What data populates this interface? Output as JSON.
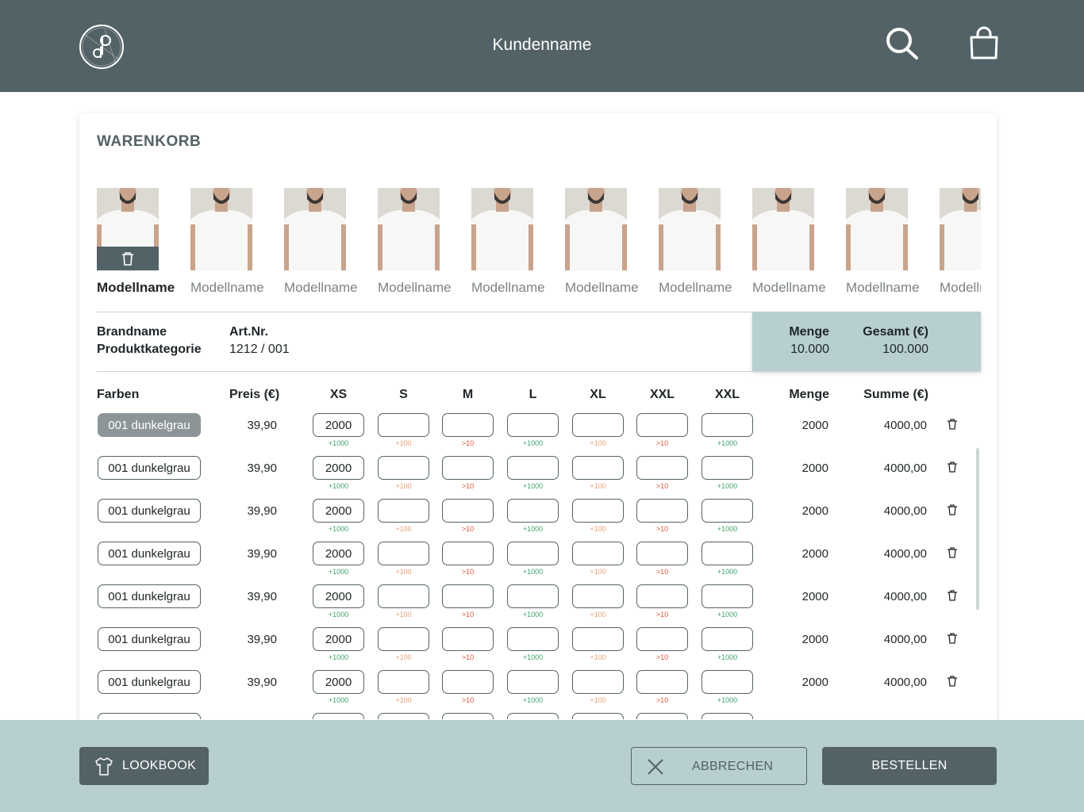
{
  "header": {
    "title": "Kundenname",
    "logo_icon": "dp-logo-icon",
    "search_icon": "search-icon",
    "cart_icon": "shopping-bag-icon"
  },
  "card": {
    "title": "WARENKORB"
  },
  "products": [
    {
      "label": "Modellname",
      "selected": true
    },
    {
      "label": "Modellname",
      "selected": false
    },
    {
      "label": "Modellname",
      "selected": false
    },
    {
      "label": "Modellname",
      "selected": false
    },
    {
      "label": "Modellname",
      "selected": false
    },
    {
      "label": "Modellname",
      "selected": false
    },
    {
      "label": "Modellname",
      "selected": false
    },
    {
      "label": "Modellname",
      "selected": false
    },
    {
      "label": "Modellname",
      "selected": false
    },
    {
      "label": "Modellname",
      "selected": false
    }
  ],
  "product_info": {
    "brand": "Brandname",
    "category": "Produktkategorie",
    "art_label": "Art.Nr.",
    "art_number": "1212 / 001",
    "qty_label": "Menge",
    "qty_value": "10.000",
    "total_label": "Gesamt (€)",
    "total_value": "100.000"
  },
  "table": {
    "headers": {
      "colors": "Farben",
      "price": "Preis (€)",
      "sizes": [
        "XS",
        "S",
        "M",
        "L",
        "XL",
        "XXL",
        "XXL"
      ],
      "qty": "Menge",
      "sum": "Summe (€)"
    },
    "hints": [
      "+1000",
      "+100",
      ">10",
      "+1000",
      "+100",
      ">10",
      "+1000"
    ],
    "hint_colors": [
      "#3fa36a",
      "#e8a07a",
      "#e0553a",
      "#3fa36a",
      "#e8a07a",
      "#e0553a",
      "#3fa36a"
    ],
    "rows": [
      {
        "color": "001 dunkelgrau",
        "active": true,
        "price": "39,90",
        "sizes": [
          "2000",
          "",
          "",
          "",
          "",
          "",
          ""
        ],
        "qty": "2000",
        "sum": "4000,00"
      },
      {
        "color": "001 dunkelgrau",
        "active": false,
        "price": "39,90",
        "sizes": [
          "2000",
          "",
          "",
          "",
          "",
          "",
          ""
        ],
        "qty": "2000",
        "sum": "4000,00"
      },
      {
        "color": "001 dunkelgrau",
        "active": false,
        "price": "39,90",
        "sizes": [
          "2000",
          "",
          "",
          "",
          "",
          "",
          ""
        ],
        "qty": "2000",
        "sum": "4000,00"
      },
      {
        "color": "001 dunkelgrau",
        "active": false,
        "price": "39,90",
        "sizes": [
          "2000",
          "",
          "",
          "",
          "",
          "",
          ""
        ],
        "qty": "2000",
        "sum": "4000,00"
      },
      {
        "color": "001 dunkelgrau",
        "active": false,
        "price": "39,90",
        "sizes": [
          "2000",
          "",
          "",
          "",
          "",
          "",
          ""
        ],
        "qty": "2000",
        "sum": "4000,00"
      },
      {
        "color": "001 dunkelgrau",
        "active": false,
        "price": "39,90",
        "sizes": [
          "2000",
          "",
          "",
          "",
          "",
          "",
          ""
        ],
        "qty": "2000",
        "sum": "4000,00"
      },
      {
        "color": "001 dunkelgrau",
        "active": false,
        "price": "39,90",
        "sizes": [
          "2000",
          "",
          "",
          "",
          "",
          "",
          ""
        ],
        "qty": "2000",
        "sum": "4000,00"
      },
      {
        "color": "",
        "active": false,
        "price": "",
        "sizes": [
          "",
          "",
          "",
          "",
          "",
          "",
          ""
        ],
        "qty": "",
        "sum": ""
      }
    ]
  },
  "footer": {
    "lookbook_label": "LOOKBOOK",
    "cancel_label": "ABBRECHEN",
    "order_label": "BESTELLEN"
  },
  "colors": {
    "header_bg": "#536266",
    "footer_bg": "#b7cfd0",
    "accent": "#536266",
    "summary_bg": "#b7cfd0"
  }
}
